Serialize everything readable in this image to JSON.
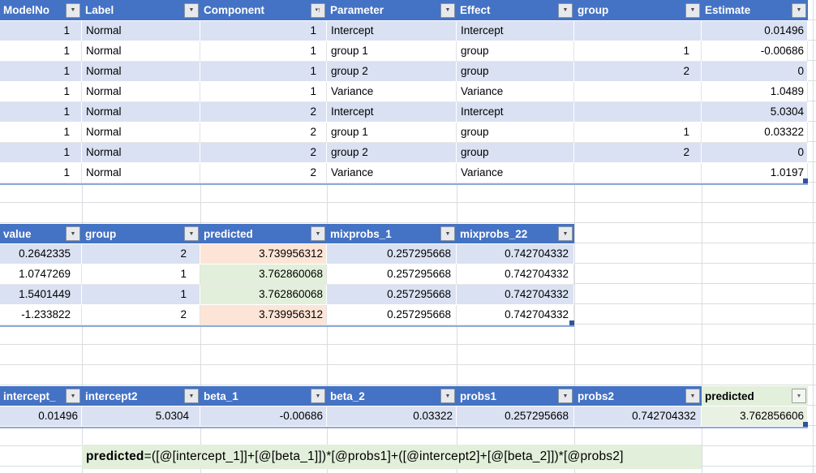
{
  "colors": {
    "header_fill": "#4472C4",
    "header_text": "#FFFFFF",
    "band_fill": "#D9E1F2",
    "highlight_peach": "#FCE4D6",
    "highlight_green": "#E2EFDA",
    "highlight_green_cell": "#E9F1E2",
    "table_border": "#8EA9DB",
    "gridline": "#D9DCDF",
    "resize_handle": "#2F5597"
  },
  "tables": [
    {
      "name": "model-estimates",
      "columns": [
        {
          "label": "ModelNo",
          "icon": "filter-dropdown-icon",
          "align": "right"
        },
        {
          "label": "Label",
          "icon": "filter-dropdown-icon",
          "align": "left"
        },
        {
          "label": "Component",
          "icon": "filter-sort-ascending-icon",
          "align": "right"
        },
        {
          "label": "Parameter",
          "icon": "filter-dropdown-icon",
          "align": "left"
        },
        {
          "label": "Effect",
          "icon": "filter-dropdown-icon",
          "align": "left"
        },
        {
          "label": "group",
          "icon": "filter-dropdown-icon",
          "align": "right"
        },
        {
          "label": "Estimate",
          "icon": "filter-dropdown-icon",
          "align": "right"
        }
      ],
      "rows": [
        [
          "1",
          "Normal",
          "1",
          "Intercept",
          "Intercept",
          "",
          "0.01496"
        ],
        [
          "1",
          "Normal",
          "1",
          "group 1",
          "group",
          "1",
          "-0.00686"
        ],
        [
          "1",
          "Normal",
          "1",
          "group 2",
          "group",
          "2",
          "0"
        ],
        [
          "1",
          "Normal",
          "1",
          "Variance",
          "Variance",
          "",
          "1.0489"
        ],
        [
          "1",
          "Normal",
          "2",
          "Intercept",
          "Intercept",
          "",
          "5.0304"
        ],
        [
          "1",
          "Normal",
          "2",
          "group 1",
          "group",
          "1",
          "0.03322"
        ],
        [
          "1",
          "Normal",
          "2",
          "group 2",
          "group",
          "2",
          "0"
        ],
        [
          "1",
          "Normal",
          "2",
          "Variance",
          "Variance",
          "",
          "1.0197"
        ]
      ],
      "highlights": []
    },
    {
      "name": "predictions",
      "columns": [
        {
          "label": "value",
          "icon": "filter-dropdown-icon",
          "align": "right"
        },
        {
          "label": "group",
          "icon": "filter-dropdown-icon",
          "align": "right"
        },
        {
          "label": "predicted",
          "icon": "filter-dropdown-icon",
          "align": "right"
        },
        {
          "label": "mixprobs_1",
          "icon": "filter-dropdown-icon",
          "align": "right"
        },
        {
          "label": "mixprobs_22",
          "icon": "filter-dropdown-icon",
          "align": "right"
        }
      ],
      "rows": [
        [
          "0.2642335",
          "2",
          "3.739956312",
          "0.257295668",
          "0.742704332"
        ],
        [
          "1.0747269",
          "1",
          "3.762860068",
          "0.257295668",
          "0.742704332"
        ],
        [
          "1.5401449",
          "1",
          "3.762860068",
          "0.257295668",
          "0.742704332"
        ],
        [
          "-1.233822",
          "2",
          "3.739956312",
          "0.257295668",
          "0.742704332"
        ]
      ],
      "highlights": [
        {
          "row": 0,
          "col": 2,
          "color": "#FCE4D6"
        },
        {
          "row": 1,
          "col": 2,
          "color": "#E2EFDA"
        },
        {
          "row": 2,
          "col": 2,
          "color": "#E2EFDA"
        },
        {
          "row": 3,
          "col": 2,
          "color": "#FCE4D6"
        }
      ]
    },
    {
      "name": "calculation",
      "columns": [
        {
          "label": "intercept_",
          "icon": "filter-dropdown-icon",
          "align": "right"
        },
        {
          "label": "intercept2",
          "icon": "filter-dropdown-icon",
          "align": "right"
        },
        {
          "label": "beta_1",
          "icon": "filter-dropdown-icon",
          "align": "right"
        },
        {
          "label": "beta_2",
          "icon": "filter-dropdown-icon",
          "align": "right"
        },
        {
          "label": "probs1",
          "icon": "filter-dropdown-icon",
          "align": "right"
        },
        {
          "label": "probs2",
          "icon": "filter-dropdown-icon",
          "align": "right"
        },
        {
          "label": "predicted",
          "icon": "filter-dropdown-icon",
          "align": "right",
          "header_style": "green"
        }
      ],
      "rows": [
        [
          "0.01496",
          "5.0304",
          "-0.00686",
          "0.03322",
          "0.257295668",
          "0.742704332",
          "3.762856606"
        ]
      ],
      "highlights": [
        {
          "row": 0,
          "col": 6,
          "color": "#E9F1E2"
        }
      ]
    }
  ],
  "formula_note": {
    "label": "predicted",
    "expression": "=([@[intercept_1]]+[@[beta_1]])*[@probs1]+([@intercept2]+[@[beta_2]])*[@probs2]"
  }
}
